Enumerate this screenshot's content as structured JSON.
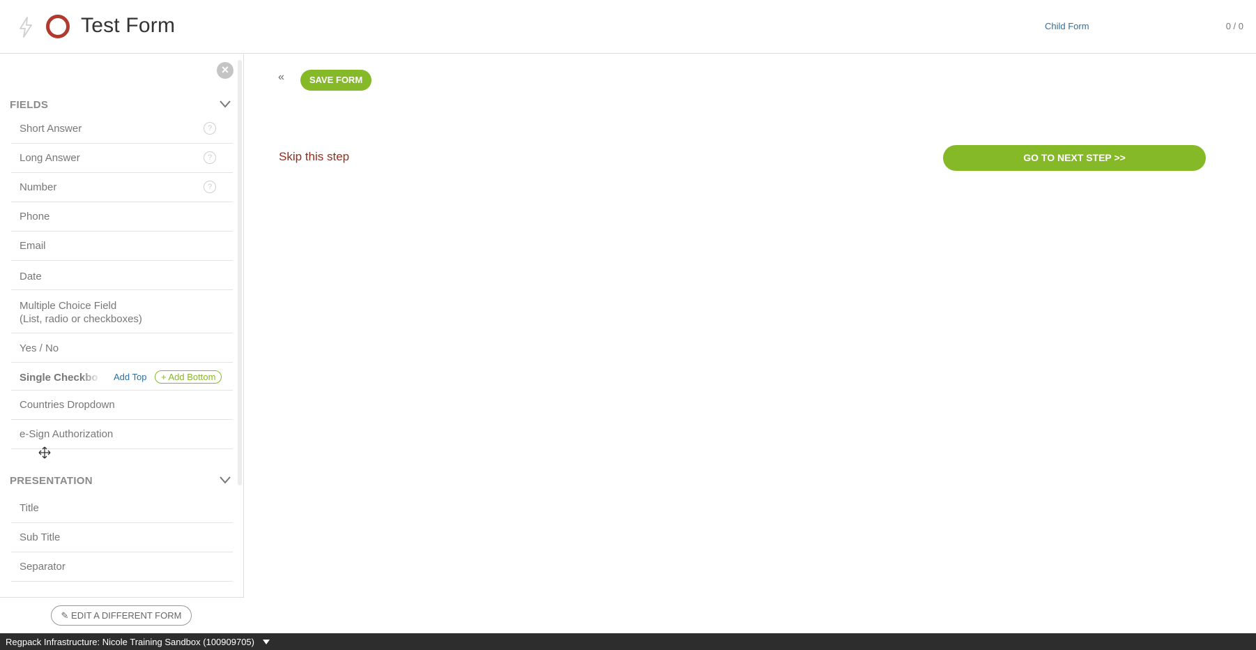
{
  "header": {
    "title": "Test Form",
    "child_form_link": "Child Form",
    "counter": "0 / 0",
    "icons": {
      "bolt": "lightning-bolt-icon",
      "logo": "ring-logo-icon"
    }
  },
  "sidebar": {
    "close_symbol": "×",
    "fields_section": {
      "label": "FIELDS",
      "items": [
        {
          "label": "Short Answer",
          "help": "?"
        },
        {
          "label": "Long Answer",
          "help": "?"
        },
        {
          "label": "Number",
          "help": "?"
        },
        {
          "label": "Phone"
        },
        {
          "label": "Email"
        },
        {
          "label": "Date"
        },
        {
          "label": "Multiple Choice Field",
          "label_line2": "(List, radio or checkboxes)"
        },
        {
          "label": "Yes / No"
        },
        {
          "label": "Single Checkbox",
          "add_top": "Add Top",
          "add_bottom": "+ Add Bottom"
        },
        {
          "label": "Countries Dropdown"
        },
        {
          "label": "e-Sign Authorization"
        }
      ]
    },
    "presentation_section": {
      "label": "PRESENTATION",
      "items": [
        {
          "label": "Title"
        },
        {
          "label": "Sub Title"
        },
        {
          "label": "Separator"
        }
      ]
    },
    "edit_different_form": "EDIT A DIFFERENT FORM"
  },
  "main": {
    "collapse_symbol": "«",
    "save_form": "SAVE FORM",
    "skip_step": "Skip this step",
    "next_step": "GO TO NEXT STEP >>"
  },
  "statusbar": {
    "text": "Regpack Infrastructure: Nicole Training Sandbox (100909705)"
  },
  "colors": {
    "accent_green": "#86b928",
    "brand_red": "#b03a2e",
    "link_blue": "#2f6f9f",
    "skip_red": "#9b2a1b",
    "statusbar_bg": "#2d2d2d"
  }
}
